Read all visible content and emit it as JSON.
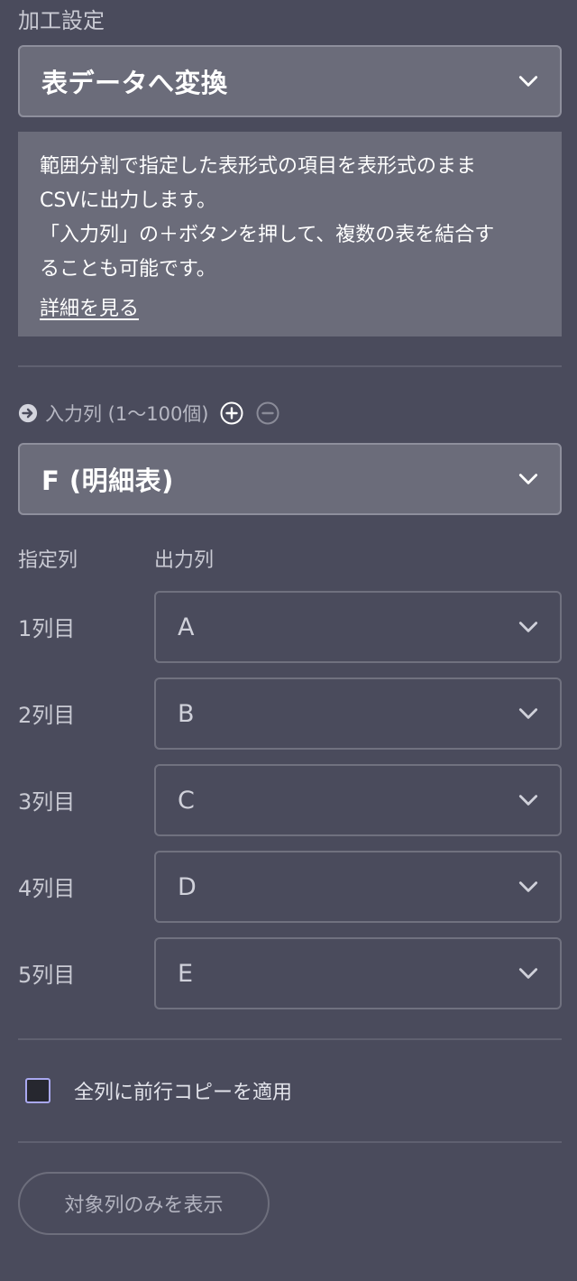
{
  "processing": {
    "label": "加工設定",
    "selected": "表データへ変換",
    "description_lines": [
      "範囲分割で指定した表形式の項目を表形式のまま",
      "CSVに出力します。",
      "「入力列」の＋ボタンを押して、複数の表を結合す",
      "ることも可能です。"
    ],
    "details_link": "詳細を見る"
  },
  "input_columns": {
    "label": "入力列 (1〜100個)",
    "add_icon": "plus-circle-icon",
    "remove_icon": "minus-circle-icon",
    "selected": "F (明細表)"
  },
  "mapping": {
    "header_specified": "指定列",
    "header_output": "出力列",
    "rows": [
      {
        "label": "1列目",
        "value": "A"
      },
      {
        "label": "2列目",
        "value": "B"
      },
      {
        "label": "3列目",
        "value": "C"
      },
      {
        "label": "4列目",
        "value": "D"
      },
      {
        "label": "5列目",
        "value": "E"
      }
    ]
  },
  "copy_option": {
    "label": "全列に前行コピーを適用",
    "checked": false
  },
  "show_target_button": "対象列のみを表示",
  "colors": {
    "background": "#4a4b5c",
    "panel": "#6b6c7a",
    "checkbox_border": "#a9a8f0"
  }
}
